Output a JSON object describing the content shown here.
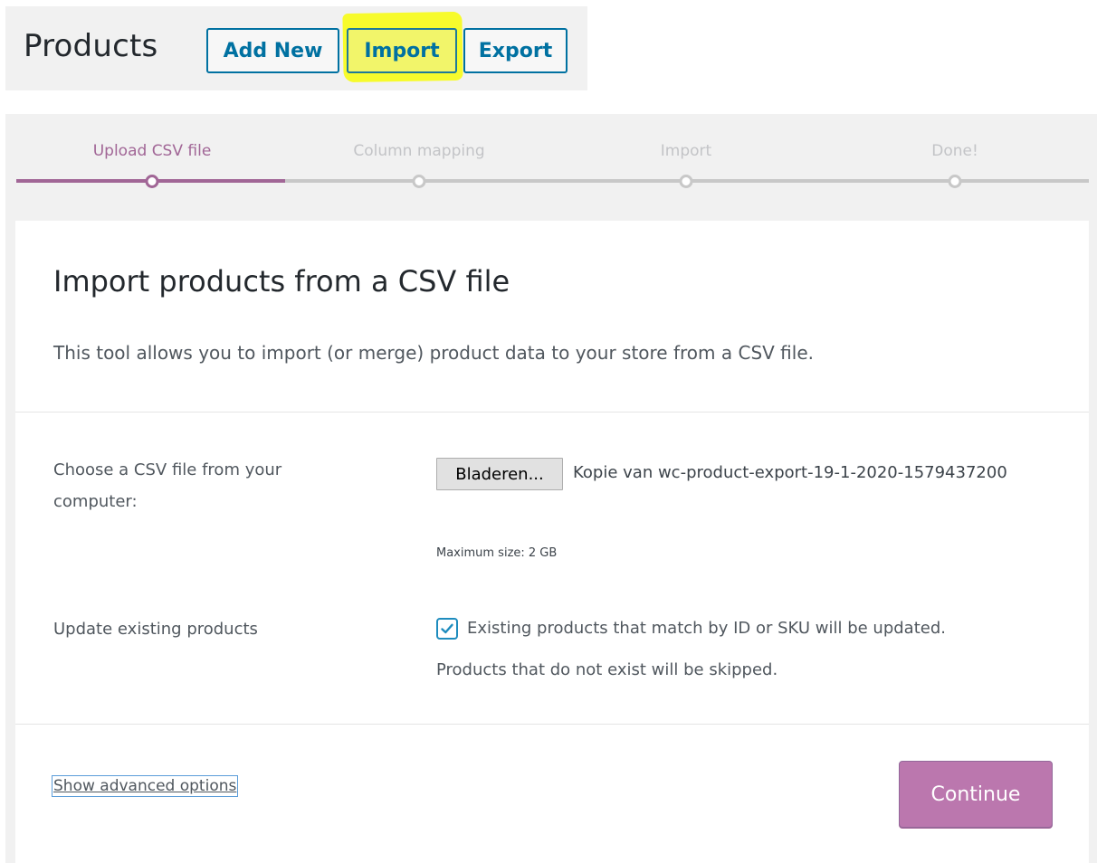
{
  "header": {
    "title": "Products",
    "add_new_label": "Add New",
    "import_label": "Import",
    "export_label": "Export",
    "highlight_color": "#f7fb2c"
  },
  "wizard": {
    "steps": [
      {
        "label": "Upload CSV file",
        "active": true
      },
      {
        "label": "Column mapping",
        "active": false
      },
      {
        "label": "Import",
        "active": false
      },
      {
        "label": "Done!",
        "active": false
      }
    ],
    "active_color": "#a16696"
  },
  "form": {
    "title": "Import products from a CSV file",
    "description": "This tool allows you to import (or merge) product data to your store from a CSV file.",
    "file_row": {
      "label": "Choose a CSV file from your computer:",
      "browse_label": "Bladeren...",
      "file_name": "Kopie van wc-product-export-19-1-2020-1579437200",
      "max_size": "Maximum size: 2 GB"
    },
    "update_row": {
      "label": "Update existing products",
      "checked": true,
      "text_line1": "Existing products that match by ID or SKU will be updated.",
      "text_line2": "Products that do not exist will be skipped."
    },
    "advanced_label": "Show advanced options",
    "continue_label": "Continue",
    "continue_color": "#bb77ae"
  }
}
